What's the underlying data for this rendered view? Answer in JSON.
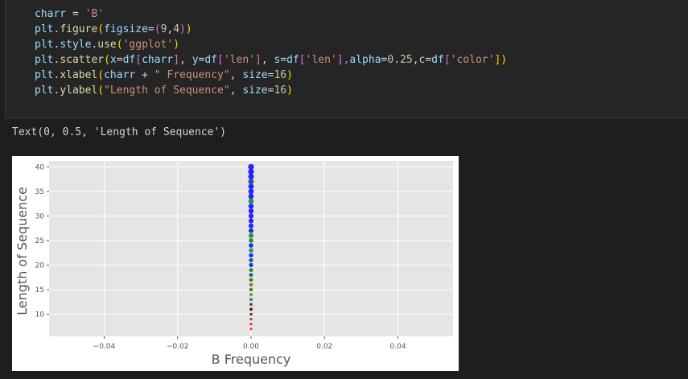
{
  "code": {
    "l1": {
      "a": "charr",
      "b": " = ",
      "c": "'B'"
    },
    "l2": {
      "a": "plt",
      "b": ".",
      "c": "figure",
      "d": "(",
      "e": "figsize",
      "f": "=",
      "g": "(",
      "h": "9",
      "i": ",",
      "j": "4",
      "k": ")",
      "l": ")"
    },
    "l3": {
      "a": "plt",
      "b": ".",
      "c": "style",
      "d": ".",
      "e": "use",
      "f": "(",
      "g": "'ggplot'",
      "h": ")"
    },
    "l4": {
      "a": "plt",
      "b": ".",
      "c": "scatter",
      "d": "(",
      "e": "x",
      "f": "=",
      "g": "df",
      "h": "[",
      "i": "charr",
      "j": "]",
      "k": ", ",
      "l": "y",
      "m": "=",
      "n": "df",
      "o": "[",
      "p": "'len'",
      "q": "]",
      "r": ", ",
      "s": "s",
      "t": "=",
      "u": "df",
      "v": "[",
      "w": "'len'",
      "x": "],",
      "y": "alpha",
      "z": "=",
      "aa": "0.25",
      "ab": ",",
      "ac": "c",
      "ad": "=",
      "ae": "df",
      "af": "[",
      "ag": "'color'",
      "ah": "])"
    },
    "l5": {
      "a": "plt",
      "b": ".",
      "c": "xlabel",
      "d": "(",
      "e": "charr",
      "f": " + ",
      "g": "\" Frequency\"",
      "h": ", ",
      "i": "size",
      "j": "=",
      "k": "16",
      "l": ")"
    },
    "l6": {
      "a": "plt",
      "b": ".",
      "c": "ylabel",
      "d": "(",
      "e": "\"Length of Sequence\"",
      "f": ", ",
      "g": "size",
      "h": "=",
      "i": "16",
      "j": ")"
    }
  },
  "output": {
    "text": "Text(0, 0.5, 'Length of Sequence')"
  },
  "chart_data": {
    "type": "scatter",
    "xlabel": "B Frequency",
    "ylabel": "Length of Sequence",
    "xlim": [
      -0.055,
      0.055
    ],
    "ylim": [
      5.5,
      41.2
    ],
    "xticks": [
      -0.04,
      -0.02,
      0.0,
      0.02,
      0.04
    ],
    "xtick_labels": [
      "−0.04",
      "−0.02",
      "0.00",
      "0.02",
      "0.04"
    ],
    "yticks": [
      10,
      15,
      20,
      25,
      30,
      35,
      40
    ],
    "ytick_labels": [
      "10",
      "15",
      "20",
      "25",
      "30",
      "35",
      "40"
    ],
    "style": "ggplot",
    "grid": true,
    "points": [
      {
        "x": 0,
        "y": 7,
        "color": "#ff0000"
      },
      {
        "x": 0,
        "y": 8,
        "color": "#ff0000"
      },
      {
        "x": 0,
        "y": 9,
        "color": "#804000"
      },
      {
        "x": 0,
        "y": 10,
        "color": "#800000"
      },
      {
        "x": 0,
        "y": 11,
        "color": "#000000"
      },
      {
        "x": 0,
        "y": 12,
        "color": "#404000"
      },
      {
        "x": 0,
        "y": 13,
        "color": "#008080"
      },
      {
        "x": 0,
        "y": 14,
        "color": "#808000"
      },
      {
        "x": 0,
        "y": 15,
        "color": "#008000"
      },
      {
        "x": 0,
        "y": 16,
        "color": "#806000"
      },
      {
        "x": 0,
        "y": 17,
        "color": "#008000"
      },
      {
        "x": 0,
        "y": 18,
        "color": "#004080"
      },
      {
        "x": 0,
        "y": 19,
        "color": "#008000"
      },
      {
        "x": 0,
        "y": 20,
        "color": "#0000ff"
      },
      {
        "x": 0,
        "y": 21,
        "color": "#004080"
      },
      {
        "x": 0,
        "y": 22,
        "color": "#0000ff"
      },
      {
        "x": 0,
        "y": 23,
        "color": "#008040"
      },
      {
        "x": 0,
        "y": 24,
        "color": "#0000ff"
      },
      {
        "x": 0,
        "y": 25,
        "color": "#008000"
      },
      {
        "x": 0,
        "y": 26,
        "color": "#008000"
      },
      {
        "x": 0,
        "y": 27,
        "color": "#0000ff"
      },
      {
        "x": 0,
        "y": 28,
        "color": "#0000ff"
      },
      {
        "x": 0,
        "y": 29,
        "color": "#0000ff"
      },
      {
        "x": 0,
        "y": 30,
        "color": "#0000ff"
      },
      {
        "x": 0,
        "y": 31,
        "color": "#0000ff"
      },
      {
        "x": 0,
        "y": 32,
        "color": "#0000ff"
      },
      {
        "x": 0,
        "y": 33,
        "color": "#008040"
      },
      {
        "x": 0,
        "y": 34,
        "color": "#0000ff"
      },
      {
        "x": 0,
        "y": 35,
        "color": "#0000ff"
      },
      {
        "x": 0,
        "y": 36,
        "color": "#0000ff"
      },
      {
        "x": 0,
        "y": 37,
        "color": "#004080"
      },
      {
        "x": 0,
        "y": 38,
        "color": "#0000ff"
      },
      {
        "x": 0,
        "y": 39,
        "color": "#0000ff"
      },
      {
        "x": 0,
        "y": 40,
        "color": "#0000ff"
      }
    ]
  }
}
